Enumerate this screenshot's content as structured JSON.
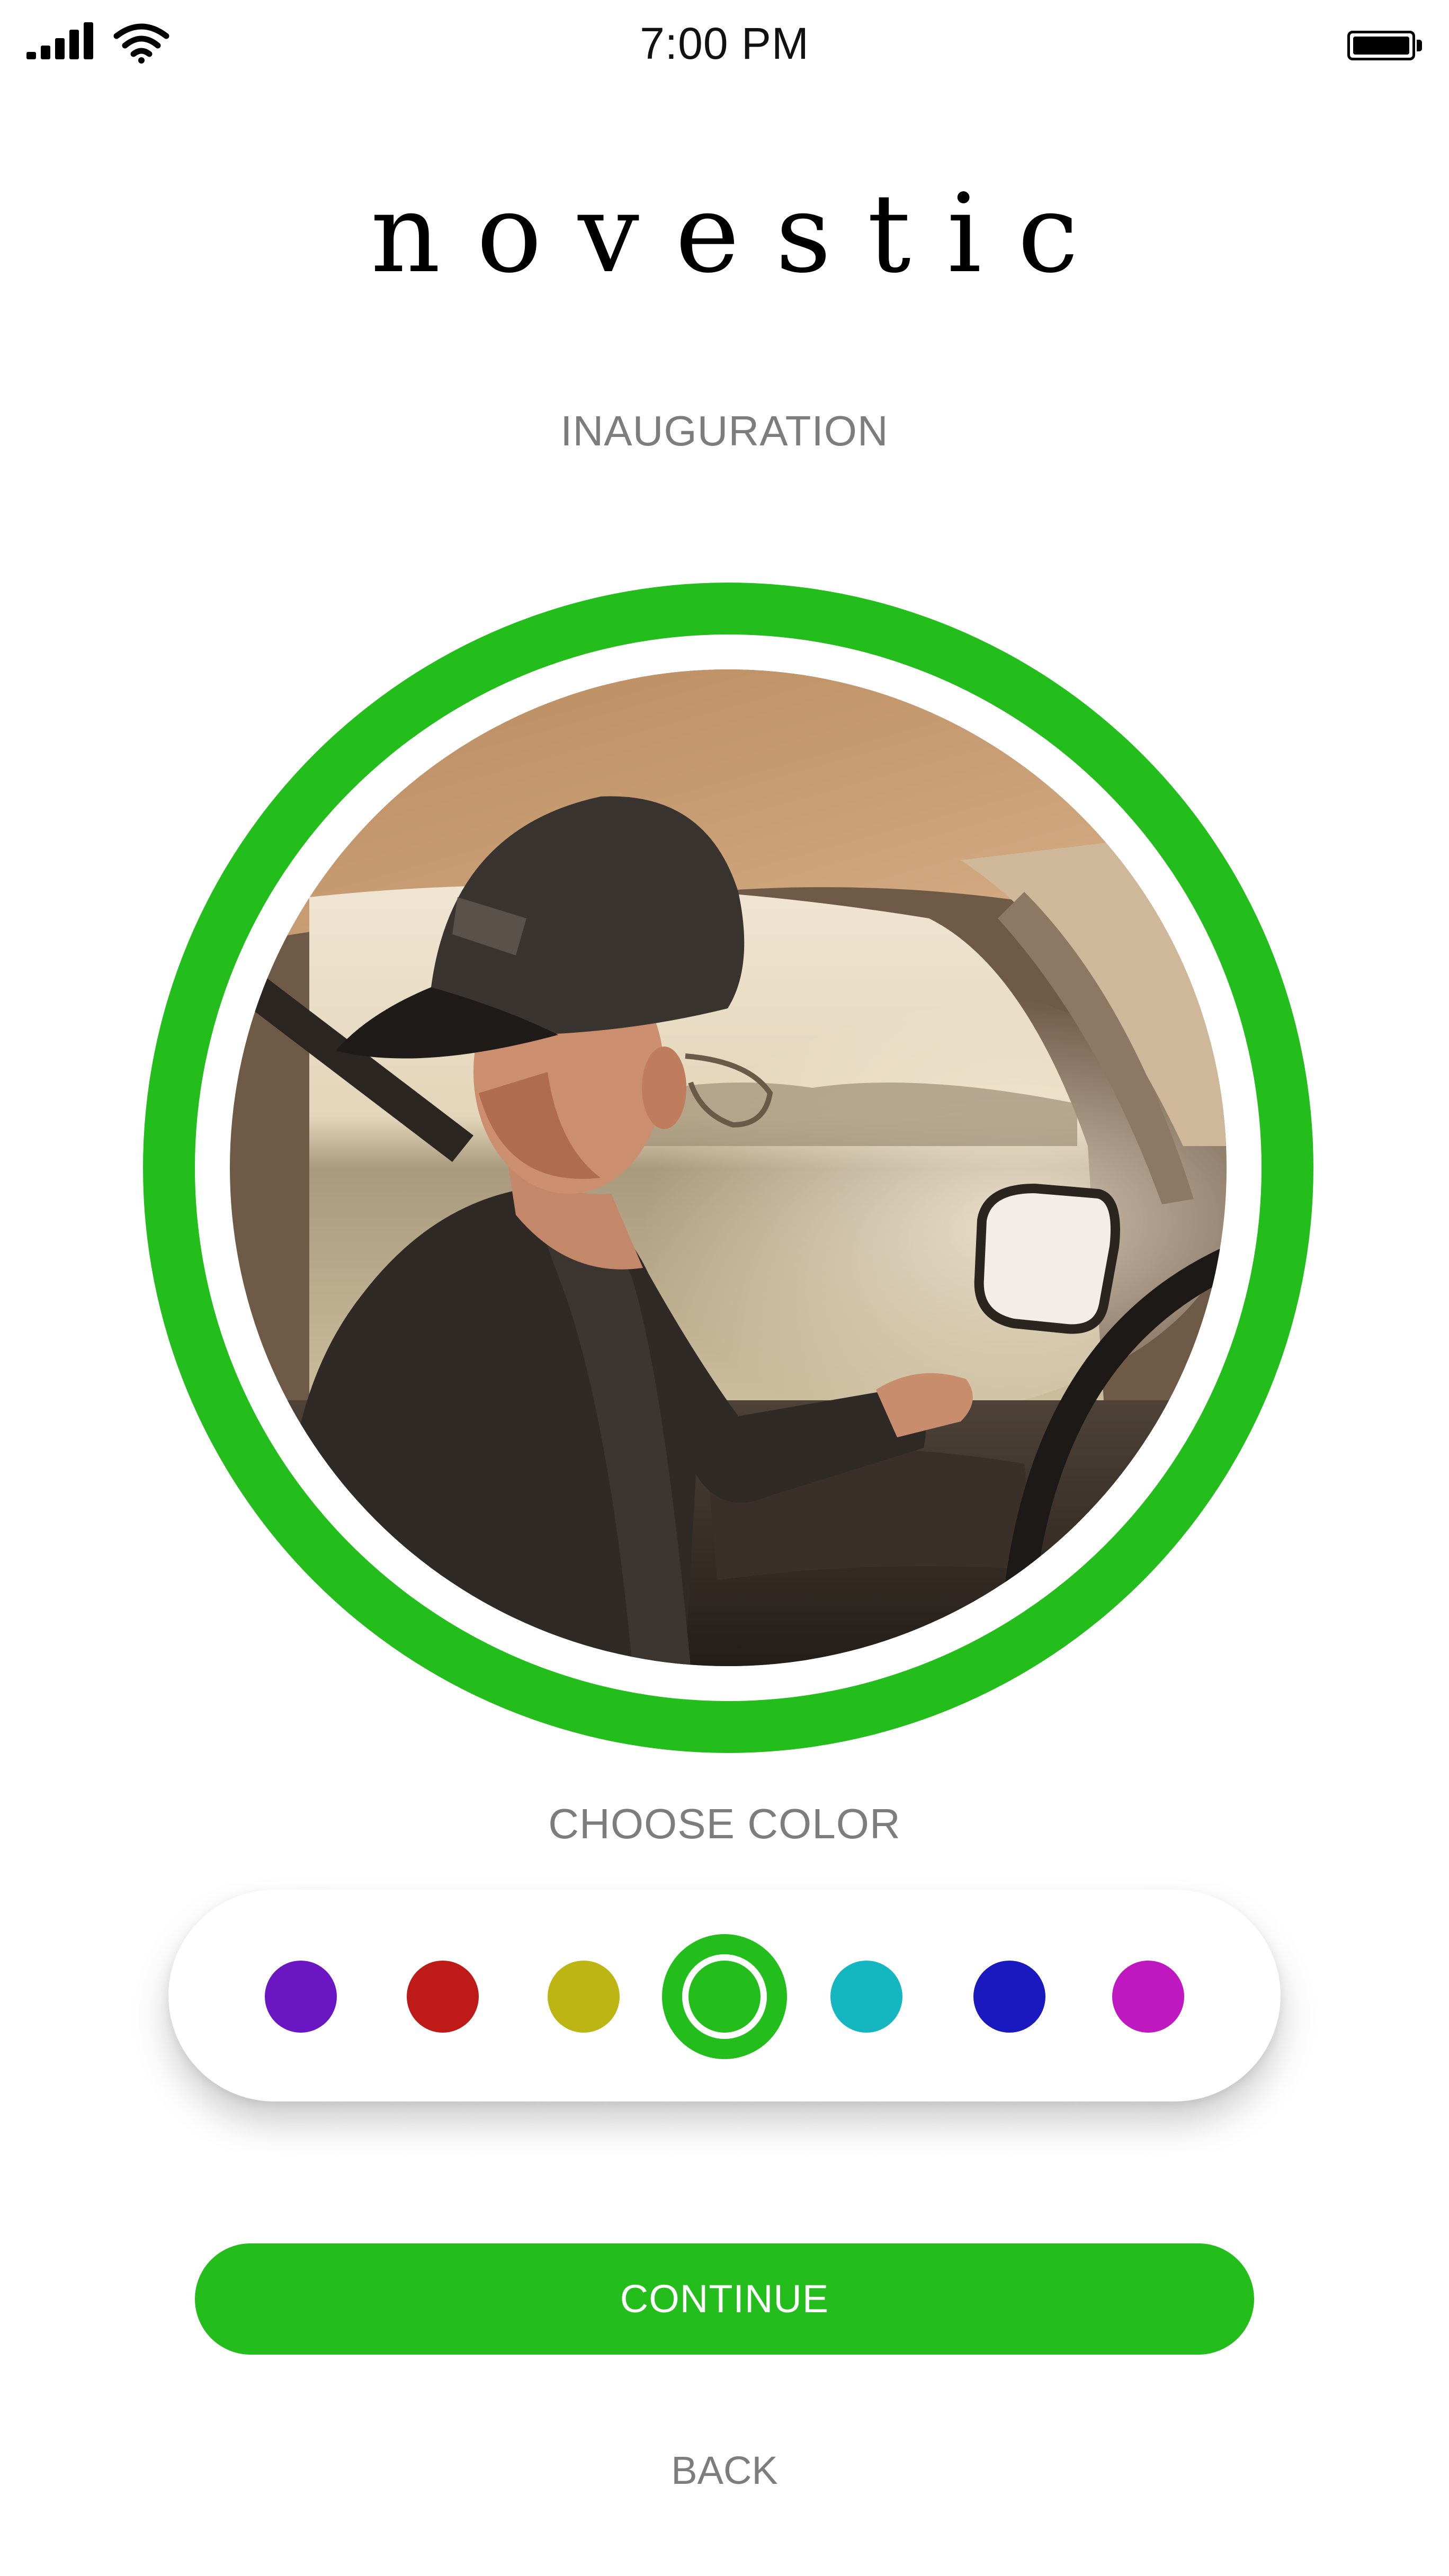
{
  "status_bar": {
    "time": "7:00 PM",
    "signal_icon": "cellular-signal-icon",
    "wifi_icon": "wifi-icon",
    "battery_icon": "battery-icon"
  },
  "app": {
    "logo": "novestic",
    "subtitle": "INAUGURATION"
  },
  "avatar": {
    "ring_color": "#23be1c",
    "photo": "profile-photo"
  },
  "color_picker": {
    "label": "CHOOSE COLOR",
    "selected_index": 3,
    "options": [
      {
        "name": "purple",
        "color": "#6a16c2"
      },
      {
        "name": "red",
        "color": "#be1a18"
      },
      {
        "name": "olive",
        "color": "#bdb514"
      },
      {
        "name": "green",
        "color": "#23be1c"
      },
      {
        "name": "teal",
        "color": "#14b6bf"
      },
      {
        "name": "blue",
        "color": "#1a18bf"
      },
      {
        "name": "magenta",
        "color": "#bf18c0"
      }
    ]
  },
  "actions": {
    "continue_label": "CONTINUE",
    "back_label": "BACK"
  },
  "colors": {
    "accent": "#23be1c",
    "muted_text": "#7d7d7d"
  }
}
